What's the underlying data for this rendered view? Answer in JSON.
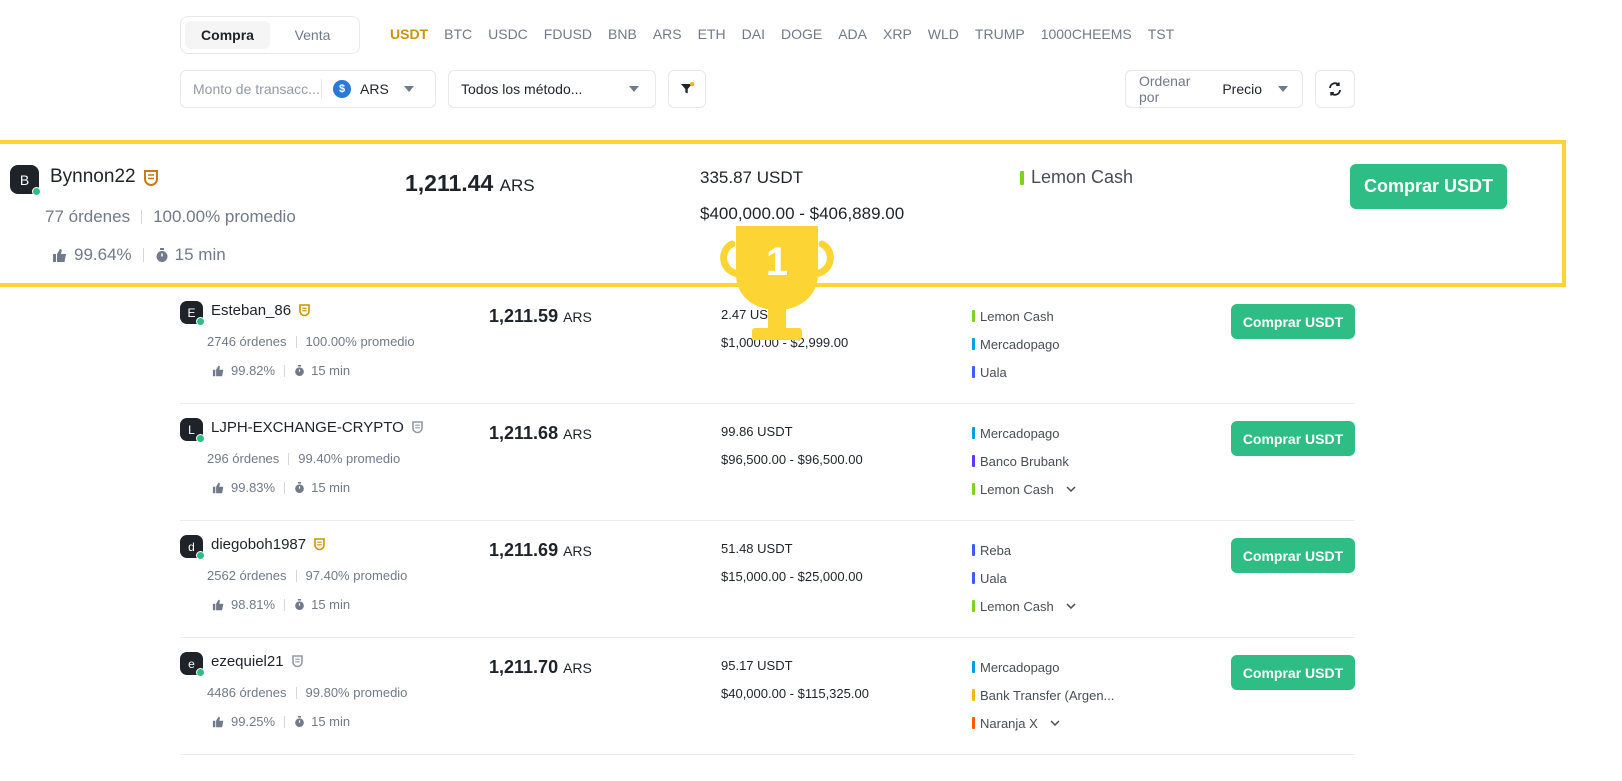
{
  "trade_tabs": [
    {
      "label": "Compra",
      "active": true
    },
    {
      "label": "Venta",
      "active": false
    }
  ],
  "assets": [
    {
      "label": "USDT",
      "active": true
    },
    {
      "label": "BTC"
    },
    {
      "label": "USDC"
    },
    {
      "label": "FDUSD"
    },
    {
      "label": "BNB"
    },
    {
      "label": "ARS"
    },
    {
      "label": "ETH"
    },
    {
      "label": "DAI"
    },
    {
      "label": "DOGE"
    },
    {
      "label": "ADA"
    },
    {
      "label": "XRP"
    },
    {
      "label": "WLD"
    },
    {
      "label": "TRUMP"
    },
    {
      "label": "1000CHEEMS"
    },
    {
      "label": "TST"
    }
  ],
  "filters": {
    "amount_placeholder": "Monto de transacc...",
    "fiat_symbol": "$",
    "fiat": "ARS",
    "payment_method": "Todos los método...",
    "sort_label": "Ordenar por",
    "sort_value": "Precio"
  },
  "colors": {
    "accent": "#c99400",
    "buy_green": "#2ebd85",
    "highlight_border": "#fcd535",
    "trophy": "#fcd535"
  },
  "trophy_rank": "1",
  "highlighted_offer": {
    "avatar": "B",
    "name": "Bynnon22",
    "orders": "77 órdenes",
    "completion": "100.00% promedio",
    "rating": "99.64%",
    "time": "15 min",
    "price": "1,211.44",
    "price_unit": "ARS",
    "available": "335.87 USDT",
    "limit": "$400,000.00 - $406,889.00",
    "methods": [
      {
        "name": "Lemon Cash",
        "color": "#7ed321"
      }
    ],
    "buy_label": "Comprar USDT"
  },
  "offers": [
    {
      "avatar": "E",
      "name": "Esteban_86",
      "badge_color": "#c99400",
      "orders": "2746 órdenes",
      "completion": "100.00% promedio",
      "rating": "99.82%",
      "time": "15 min",
      "price": "1,211.59",
      "price_unit": "ARS",
      "available": "2.47 USDT",
      "limit": "$1,000.00 - $2,999.00",
      "methods": [
        {
          "name": "Lemon Cash",
          "color": "#7ed321"
        },
        {
          "name": "Mercadopago",
          "color": "#009ee3"
        },
        {
          "name": "Uala",
          "color": "#3d5afe"
        }
      ],
      "buy_label": "Comprar USDT"
    },
    {
      "avatar": "L",
      "name": "LJPH-EXCHANGE-CRYPTO",
      "badge_color": "#929aa5",
      "orders": "296 órdenes",
      "completion": "99.40% promedio",
      "rating": "99.83%",
      "time": "15 min",
      "price": "1,211.68",
      "price_unit": "ARS",
      "available": "99.86 USDT",
      "limit": "$96,500.00 - $96,500.00",
      "methods": [
        {
          "name": "Mercadopago",
          "color": "#009ee3"
        },
        {
          "name": "Banco Brubank",
          "color": "#6236ff"
        },
        {
          "name": "Lemon Cash",
          "color": "#7ed321",
          "expand": true
        }
      ],
      "buy_label": "Comprar USDT"
    },
    {
      "avatar": "d",
      "name": "diegoboh1987",
      "badge_color": "#c99400",
      "orders": "2562 órdenes",
      "completion": "97.40% promedio",
      "rating": "98.81%",
      "time": "15 min",
      "price": "1,211.69",
      "price_unit": "ARS",
      "available": "51.48 USDT",
      "limit": "$15,000.00 - $25,000.00",
      "methods": [
        {
          "name": "Reba",
          "color": "#3d5afe"
        },
        {
          "name": "Uala",
          "color": "#3d5afe"
        },
        {
          "name": "Lemon Cash",
          "color": "#7ed321",
          "expand": true
        }
      ],
      "buy_label": "Comprar USDT"
    },
    {
      "avatar": "e",
      "name": "ezequiel21",
      "badge_color": "#929aa5",
      "orders": "4486 órdenes",
      "completion": "99.80% promedio",
      "rating": "99.25%",
      "time": "15 min",
      "price": "1,211.70",
      "price_unit": "ARS",
      "available": "95.17 USDT",
      "limit": "$40,000.00 - $115,325.00",
      "methods": [
        {
          "name": "Mercadopago",
          "color": "#009ee3"
        },
        {
          "name": "Bank Transfer (Argen...",
          "color": "#f0b90b"
        },
        {
          "name": "Naranja X",
          "color": "#ff5a00",
          "expand": true
        }
      ],
      "buy_label": "Comprar USDT"
    }
  ]
}
